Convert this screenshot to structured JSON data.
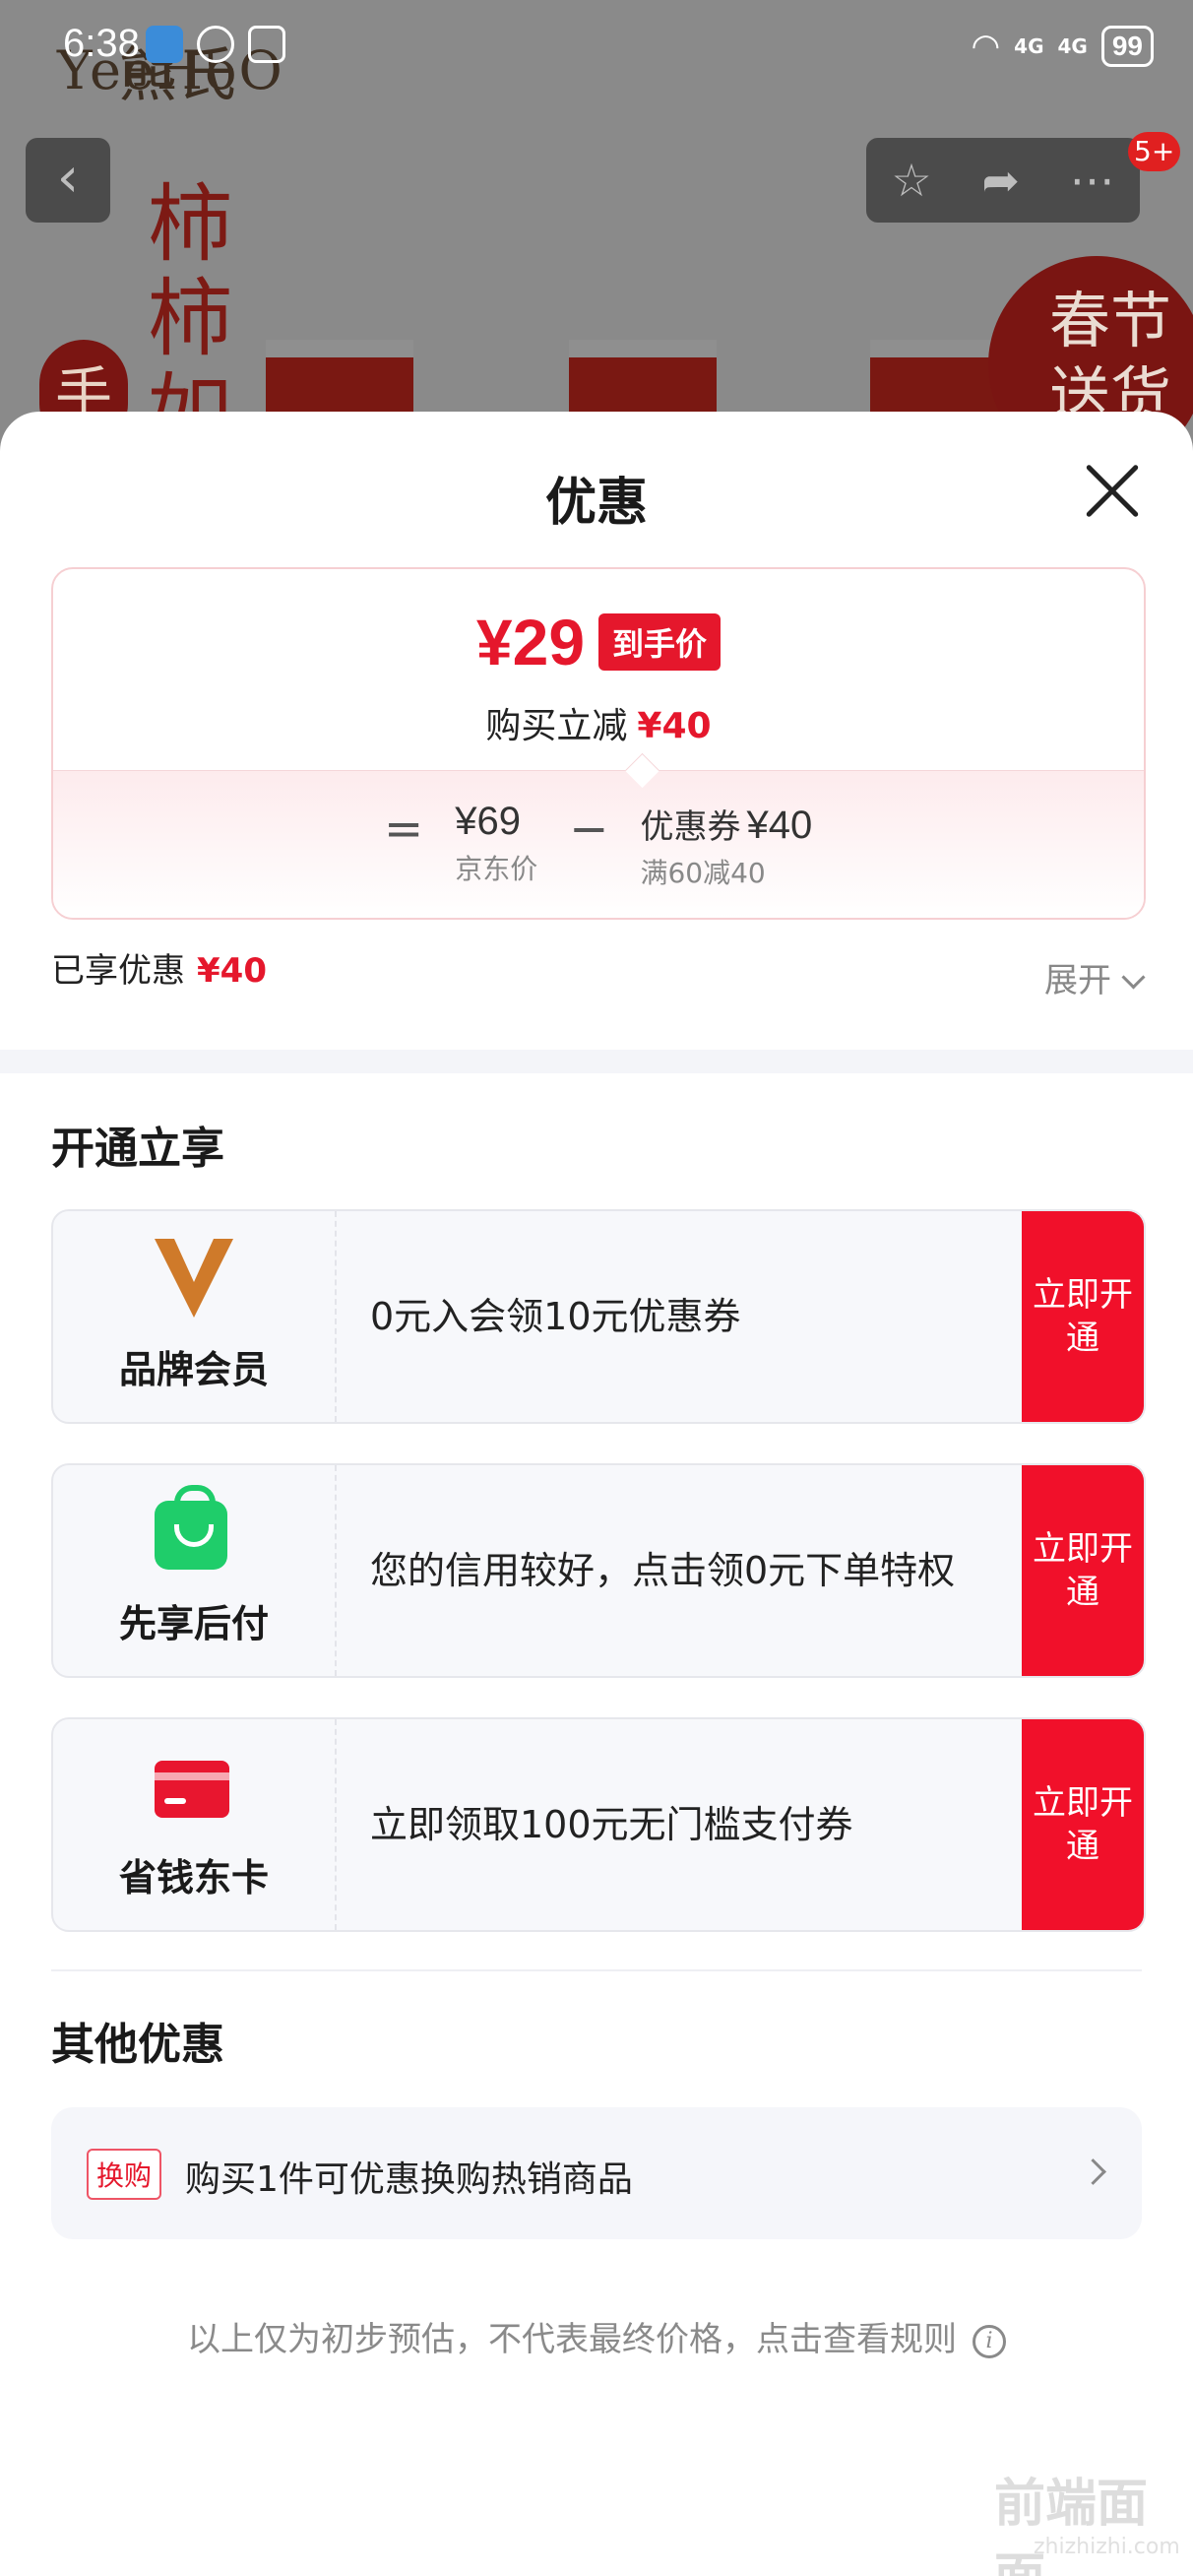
{
  "status_bar": {
    "time": "6:38",
    "signal_1": "4G",
    "signal_2": "4G",
    "battery": "99"
  },
  "background": {
    "brand_top": "熊氏",
    "brand": "YeeHoO",
    "vertical_text": "柿柿如",
    "hand_char": "手",
    "corner_badge": "春节送货",
    "cart_badge": "5+"
  },
  "sheet": {
    "title": "优惠",
    "price_card": {
      "final_price": "¥29",
      "final_price_tag": "到手价",
      "discount_label": "购买立减",
      "discount_amount": "¥40",
      "equals": "=",
      "minus": "−",
      "jd_price": "¥69",
      "jd_price_label": "京东价",
      "coupon_label": "优惠券",
      "coupon_amount": "¥40",
      "coupon_condition": "满60减40"
    },
    "enjoyed_label": "已享优惠",
    "enjoyed_amount": "¥40",
    "expand_label": "展开",
    "open_section_title": "开通立享",
    "promos": [
      {
        "name": "品牌会员",
        "icon": "brand-member-v-icon",
        "desc": "0元入会领10元优惠券",
        "button": "立即开通"
      },
      {
        "name": "先享后付",
        "icon": "shopping-bag-icon",
        "desc": "您的信用较好，点击领0元下单特权",
        "button": "立即开通"
      },
      {
        "name": "省钱东卡",
        "icon": "card-icon",
        "desc": "立即领取100元无门槛支付券",
        "button": "立即开通"
      }
    ],
    "other_section_title": "其他优惠",
    "other_offer": {
      "tag": "换购",
      "text": "购买1件可优惠换购热销商品"
    },
    "footer_note": "以上仅为初步预估，不代表最终价格，点击查看规则"
  },
  "watermark": {
    "text": "前端面面",
    "sub": "zhizhizhi.com"
  },
  "colors": {
    "accent_red": "#e5172c",
    "button_red": "#f1102a",
    "member_gold": "#cf7a2a",
    "pay_green": "#1fcd6a"
  }
}
